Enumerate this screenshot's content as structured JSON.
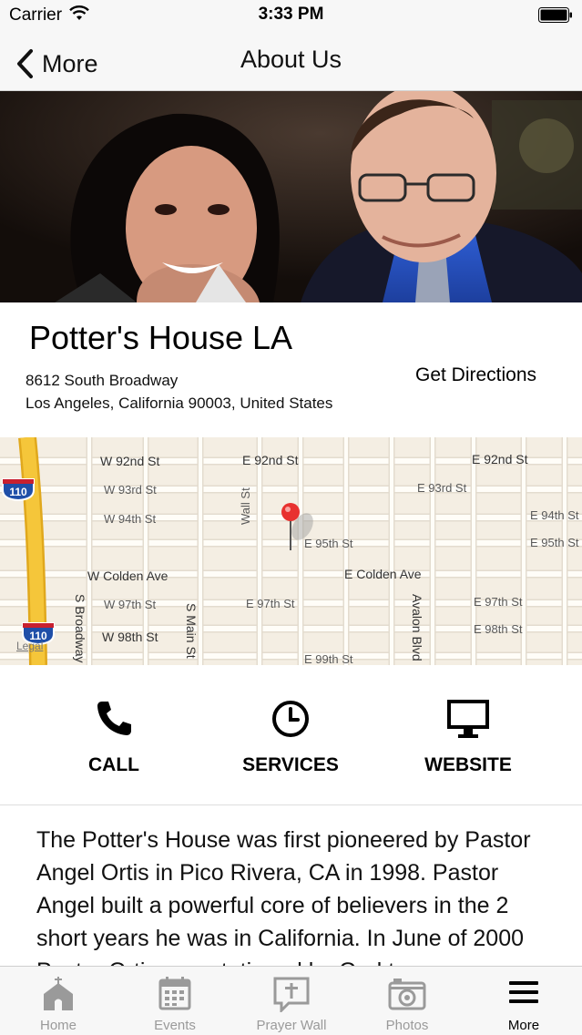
{
  "status_bar": {
    "carrier": "Carrier",
    "time": "3:33 PM"
  },
  "nav": {
    "back_label": "More",
    "title": "About Us"
  },
  "church": {
    "name": "Potter's House LA",
    "address_line1": "8612 South Broadway",
    "address_line2": "Los Angeles, California 90003, United States",
    "directions_label": "Get Directions"
  },
  "map": {
    "streets": {
      "w92": "W 92nd St",
      "e92_a": "E 92nd St",
      "e92_b": "E 92nd St",
      "w93": "W 93rd St",
      "e93": "E 93rd St",
      "w94": "W 94th St",
      "e94": "E 94th St",
      "e95_a": "E 95th St",
      "e95_b": "E 95th St",
      "w_colden": "W Colden Ave",
      "e_colden": "E Colden Ave",
      "w97": "W 97th St",
      "e97_a": "E 97th St",
      "e97_b": "E 97th St",
      "w98": "W 98th St",
      "e98": "E 98th St",
      "e99": "E 99th St",
      "wall": "Wall St",
      "s_broadway": "S Broadway",
      "s_main": "S Main St",
      "avalon": "Avalon Blvd"
    },
    "highway_shield_top": "110",
    "highway_shield_bottom": "110",
    "legal": "Legal",
    "pin_color": "#e8312f",
    "highway_color": "#f5c63a"
  },
  "actions": [
    {
      "label": "CALL",
      "icon": "phone-icon"
    },
    {
      "label": "SERVICES",
      "icon": "clock-icon"
    },
    {
      "label": "WEBSITE",
      "icon": "monitor-icon"
    }
  ],
  "description": "The Potter's House was first pioneered by Pastor Angel Ortis in Pico Rivera, CA in 1998. Pastor Angel built a powerful core of believers in the 2 short years he was in California. In June of 2000 Pastor Ortis was stationed by God to",
  "tabs": [
    {
      "label": "Home",
      "icon": "church-icon",
      "active": false
    },
    {
      "label": "Events",
      "icon": "calendar-icon",
      "active": false
    },
    {
      "label": "Prayer Wall",
      "icon": "prayer-wall-icon",
      "active": false
    },
    {
      "label": "Photos",
      "icon": "camera-icon",
      "active": false
    },
    {
      "label": "More",
      "icon": "menu-icon",
      "active": true
    }
  ]
}
